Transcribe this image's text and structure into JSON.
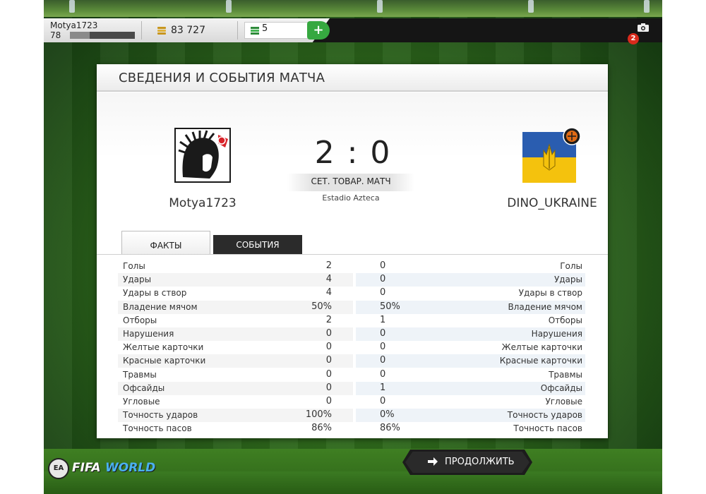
{
  "topbar": {
    "username": "Motya1723",
    "level": "78",
    "xp_progress": 0.3,
    "coins": "83 727",
    "points": "5",
    "add_label": "+",
    "notifications": "2"
  },
  "panel": {
    "title": "СВЕДЕНИЯ И СОБЫТИЯ МАТЧА",
    "home_team": "Motya1723",
    "away_team": "DINO_UKRAINE",
    "score": "2 : 0",
    "match_type": "СЕТ. ТОВАР. МАТЧ",
    "stadium": "Estadio Azteca",
    "tabs": {
      "facts": "ФАКТЫ",
      "events": "СОБЫТИЯ"
    }
  },
  "stats": [
    {
      "label": "Голы",
      "home": "2",
      "away": "0"
    },
    {
      "label": "Удары",
      "home": "4",
      "away": "0"
    },
    {
      "label": "Удары в створ",
      "home": "4",
      "away": "0"
    },
    {
      "label": "Владение мячом",
      "home": "50%",
      "away": "50%"
    },
    {
      "label": "Отборы",
      "home": "2",
      "away": "1"
    },
    {
      "label": "Нарушения",
      "home": "0",
      "away": "0"
    },
    {
      "label": "Желтые карточки",
      "home": "0",
      "away": "0"
    },
    {
      "label": "Красные карточки",
      "home": "0",
      "away": "0"
    },
    {
      "label": "Травмы",
      "home": "0",
      "away": "0"
    },
    {
      "label": "Офсайды",
      "home": "0",
      "away": "1"
    },
    {
      "label": "Угловые",
      "home": "0",
      "away": "0"
    },
    {
      "label": "Точность ударов",
      "home": "100%",
      "away": "0%"
    },
    {
      "label": "Точность пасов",
      "home": "86%",
      "away": "86%"
    }
  ],
  "bottom": {
    "ea_label": "EA",
    "fifa_label": "FIFA",
    "world_label": "WORLD",
    "continue_label": "ПРОДОЛЖИТЬ"
  },
  "colors": {
    "accent_green": "#36a840",
    "badge_red": "#d92a1c",
    "dark_bar": "#151515"
  }
}
